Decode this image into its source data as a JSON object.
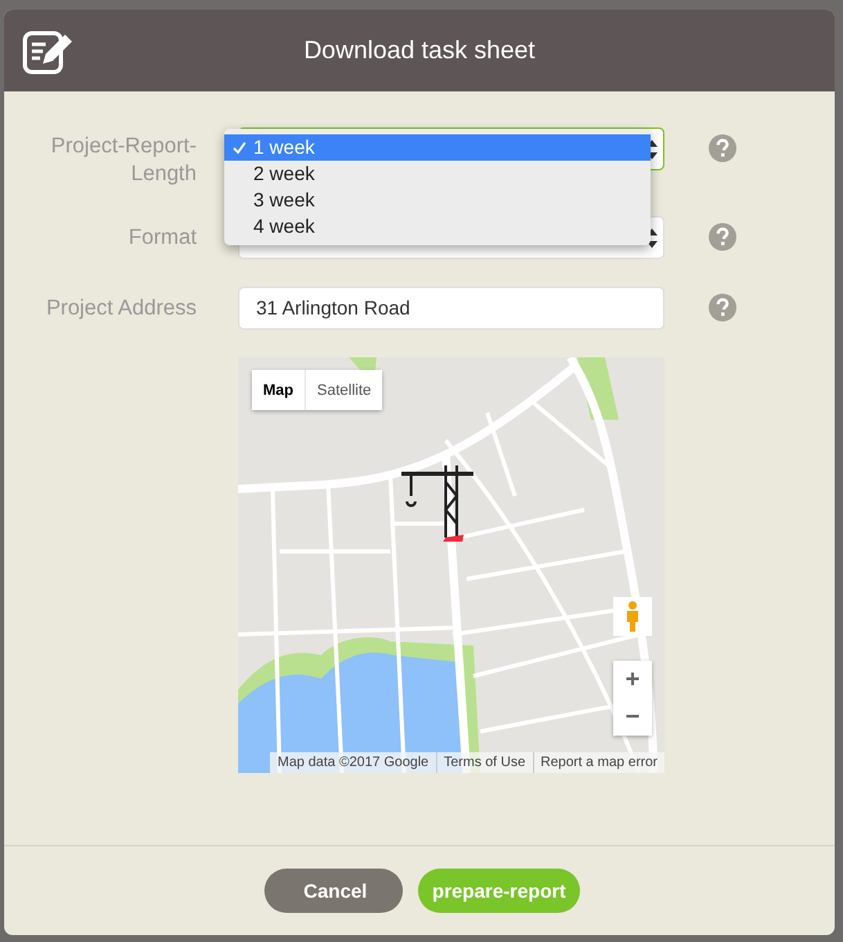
{
  "dialog": {
    "title": "Download task sheet"
  },
  "fields": [
    {
      "kind": "select",
      "label": "Project-Report-Length",
      "expanded": true,
      "options": [
        {
          "label": "1 week",
          "selected": true
        },
        {
          "label": "2 week",
          "selected": false
        },
        {
          "label": "3 week",
          "selected": false
        },
        {
          "label": "4 week",
          "selected": false
        }
      ]
    },
    {
      "kind": "select",
      "label": "Format",
      "expanded": false
    },
    {
      "kind": "text",
      "label": "Project Address",
      "value": "31 Arlington Road"
    }
  ],
  "map": {
    "map_types": [
      {
        "label": "Map",
        "selected": true
      },
      {
        "label": "Satellite",
        "selected": false
      }
    ],
    "zoom_in": "+",
    "zoom_out": "−",
    "attribution": [
      "Map data ©2017 Google",
      "Terms of Use",
      "Report a map error"
    ]
  },
  "buttons": [
    {
      "label": "Cancel",
      "kind": "secondary"
    },
    {
      "label": "prepare-report",
      "kind": "primary"
    }
  ]
}
